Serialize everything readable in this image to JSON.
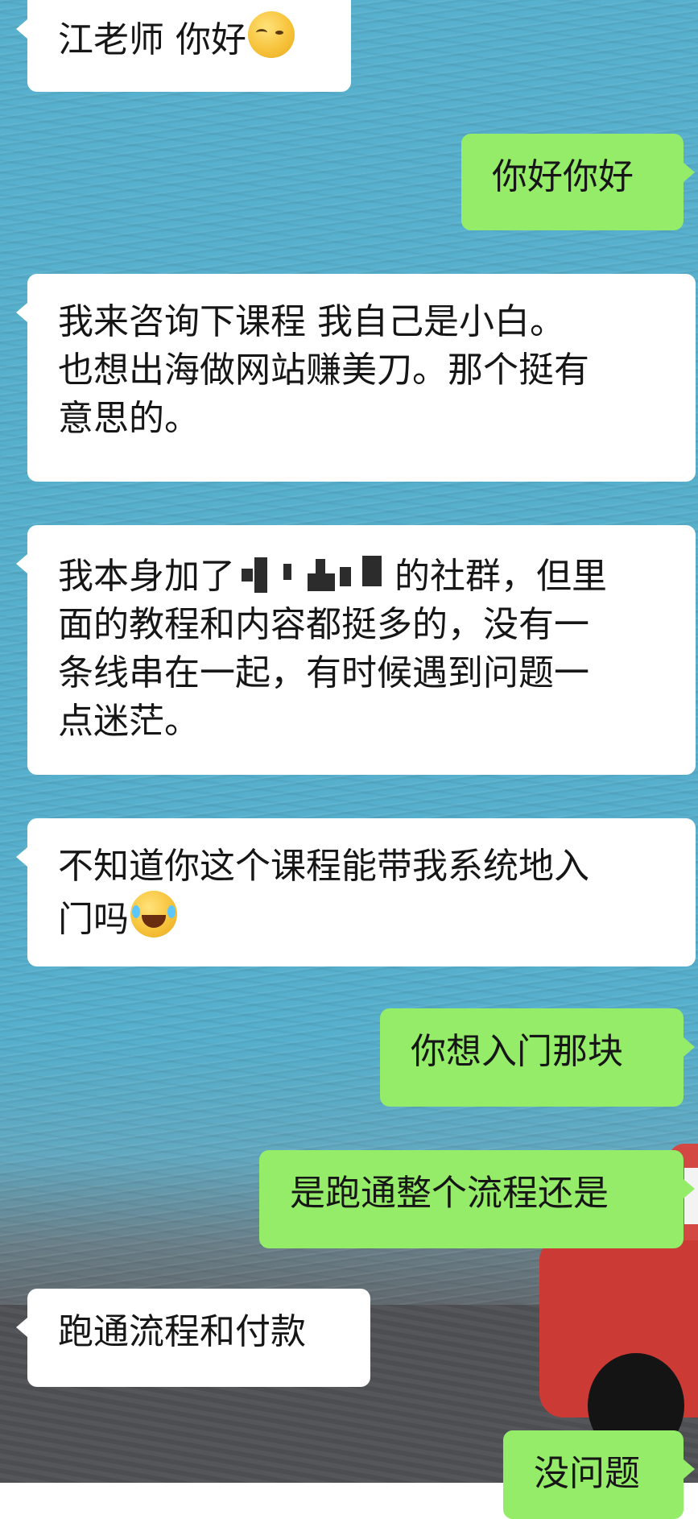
{
  "messages": [
    {
      "side": "in",
      "text": "江老师 你好",
      "emoji": "thinking-face-emoji"
    },
    {
      "side": "out",
      "text": "你好你好"
    },
    {
      "side": "in",
      "text": "我来咨询下课程 我自己是小白。\n也想出海做网站赚美刀。那个挺有\n意思的。"
    },
    {
      "side": "in",
      "text_before": "我本身加了",
      "text_after": "的社群，但里\n面的教程和内容都挺多的，没有一\n条线串在一起，有时候遇到问题一\n点迷茫。"
    },
    {
      "side": "in",
      "text": "不知道你这个课程能带我系统地入\n门吗",
      "emoji": "tears-of-joy-emoji"
    },
    {
      "side": "out",
      "text": "你想入门那块"
    },
    {
      "side": "out",
      "text": "是跑通整个流程还是"
    },
    {
      "side": "in",
      "text": "跑通流程和付款"
    },
    {
      "side": "out",
      "text": "没问题"
    }
  ],
  "colors": {
    "incoming_bubble": "#ffffff",
    "outgoing_bubble": "#95ec69",
    "background": "#57b0cd"
  }
}
